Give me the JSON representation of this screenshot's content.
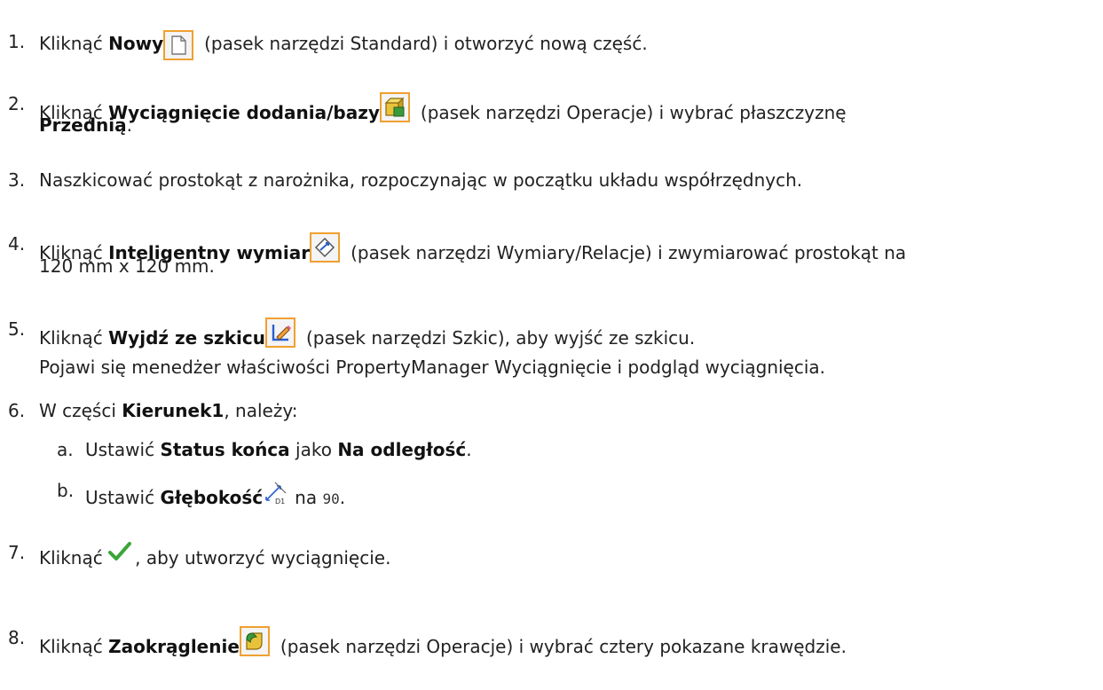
{
  "steps": [
    {
      "num": "1.",
      "pre": "Kliknąć ",
      "bold": "Nowy",
      "icon": "new-document-icon",
      "post": "(pasek narzędzi Standard) i otworzyć nową część."
    },
    {
      "num": "2.",
      "pre": "Kliknąć ",
      "bold": "Wyciągnięcie dodania/bazy",
      "icon": "extruded-boss-icon",
      "post": "(pasek narzędzi Operacje) i wybrać płaszczyznę",
      "line2_bold": "Przednią",
      "line2_post": "."
    },
    {
      "num": "3.",
      "text": "Naszkicować prostokąt z narożnika, rozpoczynając w początku układu współrzędnych."
    },
    {
      "num": "4.",
      "pre": "Kliknąć ",
      "bold": "Inteligentny wymiar",
      "icon": "smart-dimension-icon",
      "post": "(pasek narzędzi Wymiary/Relacje) i zwymiarować prostokąt na",
      "line2": "120 mm x 120 mm."
    },
    {
      "num": "5.",
      "pre": "Kliknąć ",
      "bold": "Wyjdź ze szkicu",
      "icon": "exit-sketch-icon",
      "post": "(pasek narzędzi Szkic), aby wyjść ze szkicu.",
      "line2": "Pojawi się menedżer właściwości PropertyManager Wyciągnięcie i podgląd wyciągnięcia."
    },
    {
      "num": "6.",
      "pre": "W części ",
      "bold": "Kierunek1",
      "post": ", należy:"
    },
    {
      "num": "7.",
      "pre": "Kliknąć ",
      "icon": "ok-check-icon",
      "post": ", aby utworzyć wyciągnięcie."
    },
    {
      "num": "8.",
      "pre": "Kliknąć ",
      "bold": "Zaokrąglenie",
      "icon": "fillet-icon",
      "post": "(pasek narzędzi Operacje) i wybrać cztery pokazane krawędzie."
    }
  ],
  "substeps": [
    {
      "num": "a.",
      "pre": "Ustawić ",
      "bold": "Status końca",
      "mid": " jako ",
      "bold2": "Na odległość",
      "post": "."
    },
    {
      "num": "b.",
      "pre": "Ustawić ",
      "bold": "Głębokość",
      "icon": "depth-icon",
      "mid": "na ",
      "value": "90",
      "post": "."
    }
  ],
  "colors": {
    "icon_border": "#f0a030",
    "check": "#3aa63a"
  }
}
